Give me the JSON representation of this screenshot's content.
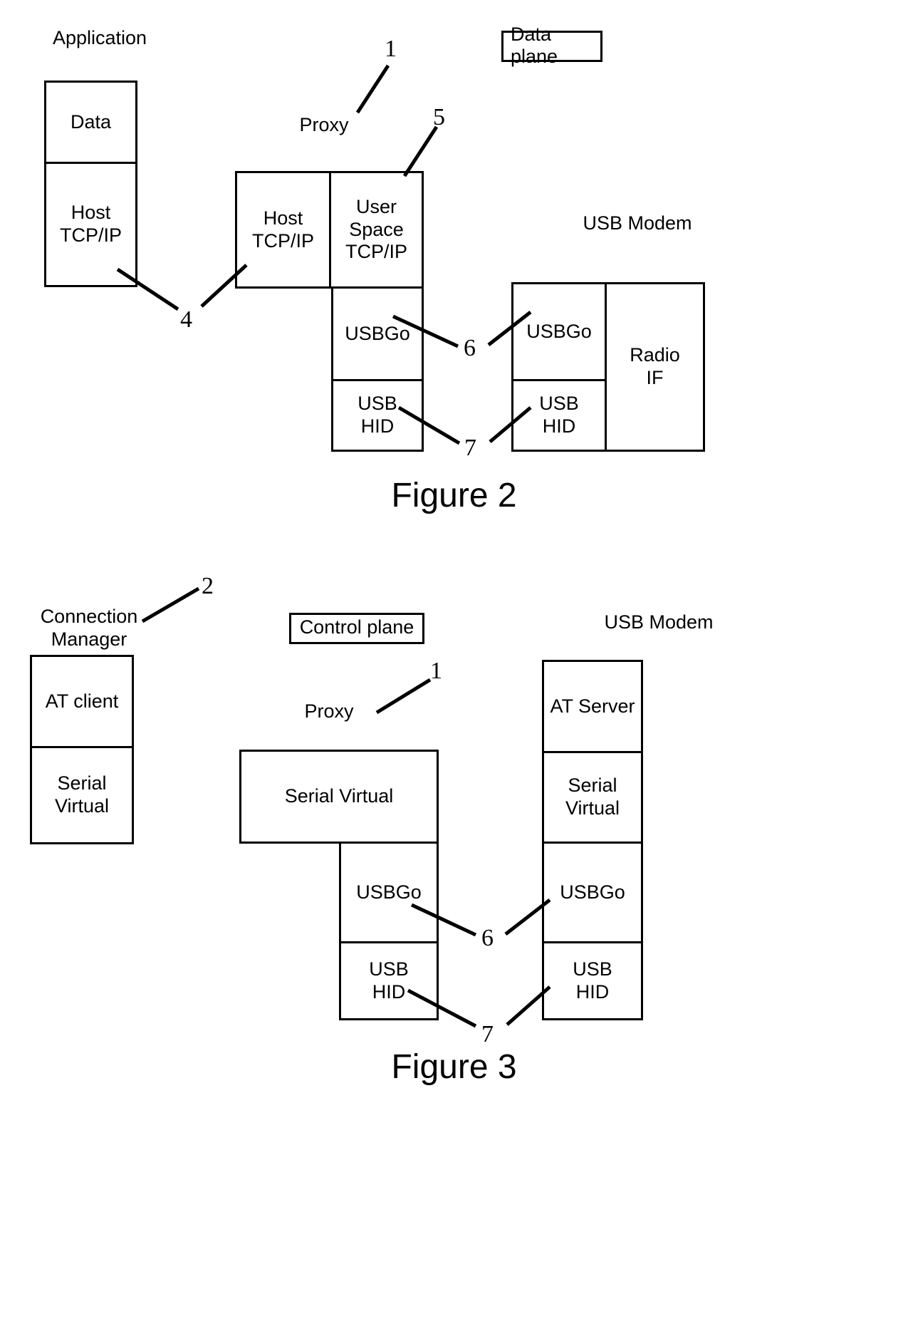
{
  "figures": [
    {
      "id": "figure-2",
      "caption": "Figure 2",
      "plane_tag": "Data plane",
      "column_headings": {
        "application": "Application",
        "proxy": "Proxy",
        "usb_modem": "USB Modem"
      },
      "boxes": {
        "app_data": "Data",
        "app_host_tcpip": "Host\nTCP/IP",
        "proxy_host_tcpip": "Host\nTCP/IP",
        "proxy_user_space_tcpip": "User\nSpace\nTCP/IP",
        "proxy_usbgo": "USBGo",
        "proxy_usb_hid": "USB\nHID",
        "modem_usbgo": "USBGo",
        "modem_usb_hid": "USB\nHID",
        "modem_radio_if": "Radio\nIF"
      },
      "reference_numerals": {
        "proxy": "1",
        "host_stack": "4",
        "user_space_tcpip": "5",
        "usbgo_link": "6",
        "usb_hid_link": "7"
      }
    },
    {
      "id": "figure-3",
      "caption": "Figure 3",
      "plane_tag": "Control plane",
      "column_headings": {
        "connection_manager": "Connection\nManager",
        "proxy": "Proxy",
        "usb_modem": "USB Modem"
      },
      "boxes": {
        "cm_at_client": "AT client",
        "cm_serial_virtual": "Serial\nVirtual",
        "proxy_serial_virtual": "Serial Virtual",
        "proxy_usbgo": "USBGo",
        "proxy_usb_hid": "USB\nHID",
        "modem_at_server": "AT Server",
        "modem_serial_virtual": "Serial\nVirtual",
        "modem_usbgo": "USBGo",
        "modem_usb_hid": "USB\nHID"
      },
      "reference_numerals": {
        "connection_manager": "2",
        "proxy": "1",
        "usbgo_link": "6",
        "usb_hid_link": "7"
      }
    }
  ],
  "colors": {
    "stroke": "#000000",
    "background": "#ffffff"
  }
}
